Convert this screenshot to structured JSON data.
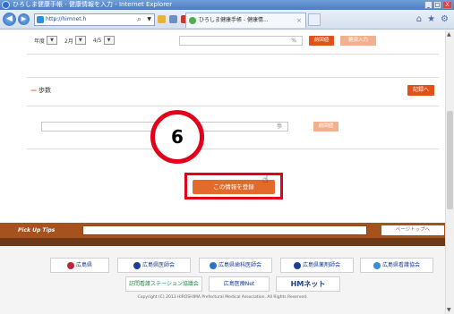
{
  "window": {
    "title": "ひろしま健康手帳 - 健康情報を入力 - Internet Explorer",
    "minimize": "_",
    "maximize": "□",
    "close": "X"
  },
  "browser": {
    "back": "◀",
    "forward": "▶",
    "address": "http://himnet.h",
    "tab_title": "ひろしま健康手帳 - 健康情..."
  },
  "date_row": {
    "year_label": "年度",
    "month_label": "2月",
    "week_label": "4/5",
    "unit": "%",
    "history_button": "前回値",
    "health_input_button": "健康入力"
  },
  "steps": {
    "title": "歩数",
    "section_button": "記録へ",
    "unit": "歩",
    "previous_button": "前回値"
  },
  "annotation": {
    "step_number": "6"
  },
  "register_button": "この情報を登録",
  "tips": {
    "label": "Pick Up Tips",
    "page_top": "ページトップへ"
  },
  "footer": {
    "logos": [
      {
        "name": "広島県",
        "color": "#c0263a"
      },
      {
        "name": "広島県医師会",
        "color": "#1b3f91"
      },
      {
        "name": "広島県歯科医師会",
        "color": "#2f73c9"
      },
      {
        "name": "広島県薬剤師会",
        "color": "#1b3f91"
      },
      {
        "name": "広島県看護協会",
        "color": "#3a8fd1"
      },
      {
        "name": "訪問看護ステーション協議会",
        "color": "#2a8a4a"
      },
      {
        "name": "広島医療Net",
        "color": "#1b3f91"
      },
      {
        "name": "HMネット",
        "color": "#1b3f91"
      }
    ],
    "copyright": "Copyright (C) 2013 HIROSHIMA Prefectural Medical Association. All Rights Reserved."
  }
}
